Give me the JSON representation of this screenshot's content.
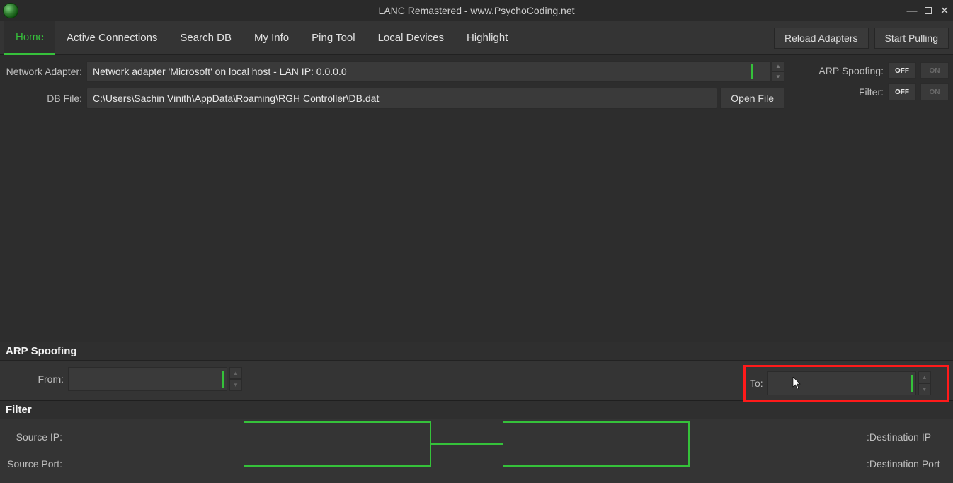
{
  "window": {
    "title": "LANC Remastered - www.PsychoCoding.net"
  },
  "tabs": {
    "home": "Home",
    "active_connections": "Active Connections",
    "search_db": "Search DB",
    "my_info": "My Info",
    "ping_tool": "Ping Tool",
    "local_devices": "Local Devices",
    "highlight": "Highlight"
  },
  "buttons": {
    "reload_adapters": "Reload Adapters",
    "start_pulling": "Start Pulling",
    "open_file": "Open File"
  },
  "labels": {
    "network_adapter": "Network Adapter:",
    "db_file": "DB File:",
    "arp_spoofing": "ARP Spoofing:",
    "filter": "Filter:",
    "off": "OFF",
    "on": "ON",
    "section_arp": "ARP Spoofing",
    "section_filter": "Filter",
    "from": "From:",
    "to": "To:",
    "source_ip": "Source IP:",
    "source_port": "Source Port:",
    "dest_ip": ":Destination IP",
    "dest_port": ":Destination Port"
  },
  "values": {
    "network_adapter": "Network adapter 'Microsoft' on local host - LAN IP: 0.0.0.0",
    "db_file": "C:\\Users\\Sachin Vinith\\AppData\\Roaming\\RGH Controller\\DB.dat",
    "arp_from": "",
    "arp_to": "",
    "source_ip": "",
    "source_port": "",
    "dest_ip": "",
    "dest_port": ""
  },
  "toggles": {
    "arp_spoofing": "OFF",
    "filter": "OFF"
  },
  "colors": {
    "accent": "#35c13a",
    "highlight_box": "#ff1a1a"
  }
}
